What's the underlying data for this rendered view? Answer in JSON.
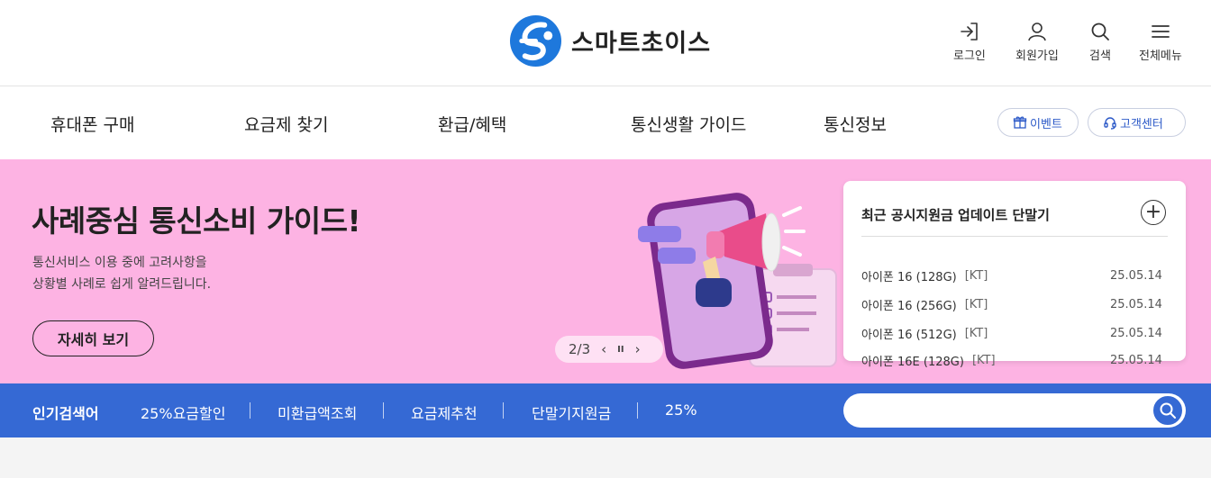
{
  "logo": {
    "name": "스마트초이스",
    "accent": "#1e78dc"
  },
  "utils": [
    {
      "label": "로그인",
      "icon": "login-icon"
    },
    {
      "label": "회원가입",
      "icon": "user-icon"
    },
    {
      "label": "검색",
      "icon": "search-icon"
    },
    {
      "label": "전체메뉴",
      "icon": "menu-icon"
    }
  ],
  "gnb": {
    "items": [
      "휴대폰 구매",
      "요금제 찾기",
      "환급/혜택",
      "통신생활 가이드",
      "통신정보"
    ],
    "event_label": "이벤트",
    "support_label": "고객센터"
  },
  "hero": {
    "title": "사례중심 통신소비 가이드!",
    "desc_line1": "통신서비스 이용 중에 고려사항을",
    "desc_line2": "상황별 사례로 쉽게 알려드립니다.",
    "button": "자세히 보기",
    "background": "#fdb3e3",
    "pager": {
      "current": "2/3",
      "prev": "‹",
      "pause": "II",
      "next": "›"
    }
  },
  "update_card": {
    "title": "최근 공시지원금 업데이트 단말기",
    "plus": "+",
    "rows": [
      {
        "model": "아이폰 16 (128G)",
        "carrier": "[KT]",
        "date": "25.05.14"
      },
      {
        "model": "아이폰 16 (256G)",
        "carrier": "[KT]",
        "date": "25.05.14"
      },
      {
        "model": "아이폰 16 (512G)",
        "carrier": "[KT]",
        "date": "25.05.14"
      },
      {
        "model": "아이폰 16E (128G)",
        "carrier": "[KT]",
        "date": "25.05.14"
      }
    ]
  },
  "popular": {
    "label": "인기검색어",
    "keywords": [
      "25%요금할인",
      "미환급액조회",
      "요금제추천",
      "단말기지원금",
      "25%"
    ],
    "bar_color": "#3569d4",
    "search_placeholder": ""
  }
}
